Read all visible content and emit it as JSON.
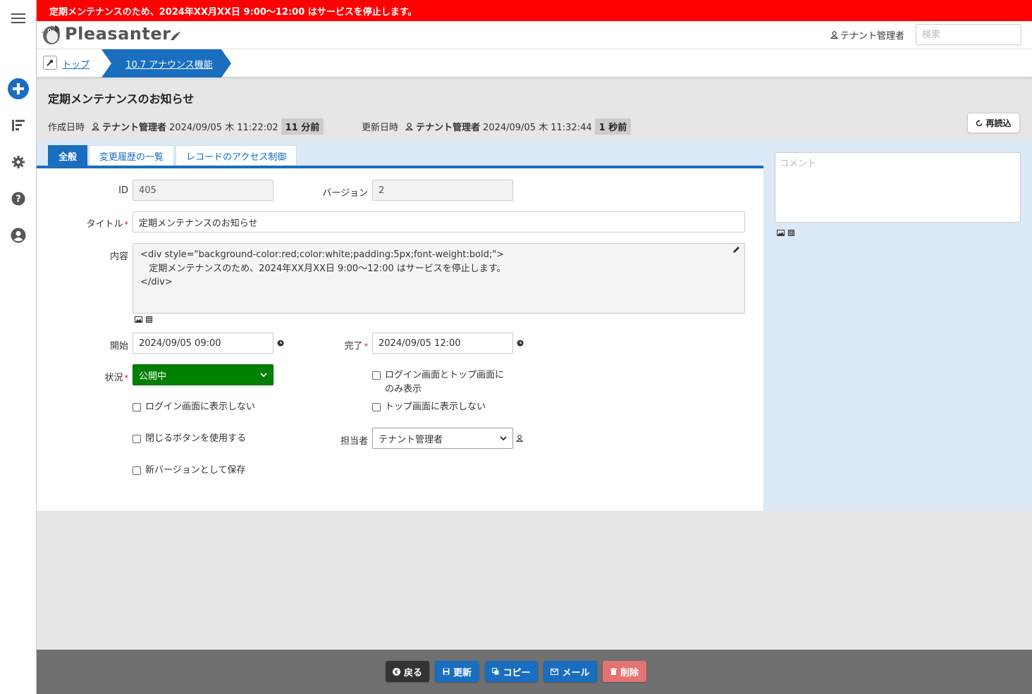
{
  "announcement": "定期メンテナンスのため、2024年XX月XX日 9:00～12:00 はサービスを停止します。",
  "header": {
    "logo_text": "Pleasanter",
    "user_name": "テナント管理者",
    "search_placeholder": "検索"
  },
  "breadcrumb": {
    "top_label": "トップ",
    "current_label": "10.7 アナウンス機能"
  },
  "record": {
    "title": "定期メンテナンスのお知らせ",
    "created_label": "作成日時",
    "created_by": "テナント管理者",
    "created_at": "2024/09/05 木 11:22:02",
    "created_ago": "11 分前",
    "updated_label": "更新日時",
    "updated_by": "テナント管理者",
    "updated_at": "2024/09/05 木 11:32:44",
    "updated_ago": "1 秒前",
    "reload_label": "再読込"
  },
  "tabs": [
    {
      "label": "全般",
      "active": true
    },
    {
      "label": "変更履歴の一覧",
      "active": false
    },
    {
      "label": "レコードのアクセス制御",
      "active": false
    }
  ],
  "form": {
    "id_label": "ID",
    "id_value": "405",
    "version_label": "バージョン",
    "version_value": "2",
    "title_label": "タイトル",
    "title_value": "定期メンテナンスのお知らせ",
    "content_label": "内容",
    "content_value": "<div style=\"background-color:red;color:white;padding:5px;font-weight:bold;\">\n   定期メンテナンスのため、2024年XX月XX日 9:00～12:00 はサービスを停止します。\n</div>",
    "start_label": "開始",
    "start_value": "2024/09/05 09:00",
    "end_label": "完了",
    "end_value": "2024/09/05 12:00",
    "status_label": "状況",
    "status_value": "公開中",
    "login_top_only_label_1": "ログイン画面とトップ画面に",
    "login_top_only_label_2": "のみ表示",
    "hide_login_label": "ログイン画面に表示しない",
    "hide_top_label": "トップ画面に表示しない",
    "close_button_label": "閉じるボタンを使用する",
    "owner_label": "担当者",
    "owner_value": "テナント管理者",
    "new_version_label": "新バージョンとして保存"
  },
  "comment": {
    "placeholder": "コメント"
  },
  "footer": {
    "back": "戻る",
    "update": "更新",
    "copy": "コピー",
    "mail": "メール",
    "delete": "削除"
  },
  "colors": {
    "banner": "#ff0000",
    "primary": "#1a6ebf",
    "status_green": "#008000",
    "delete": "#e57373",
    "footer_bg": "#707070",
    "side_panel": "#dce9f6"
  }
}
